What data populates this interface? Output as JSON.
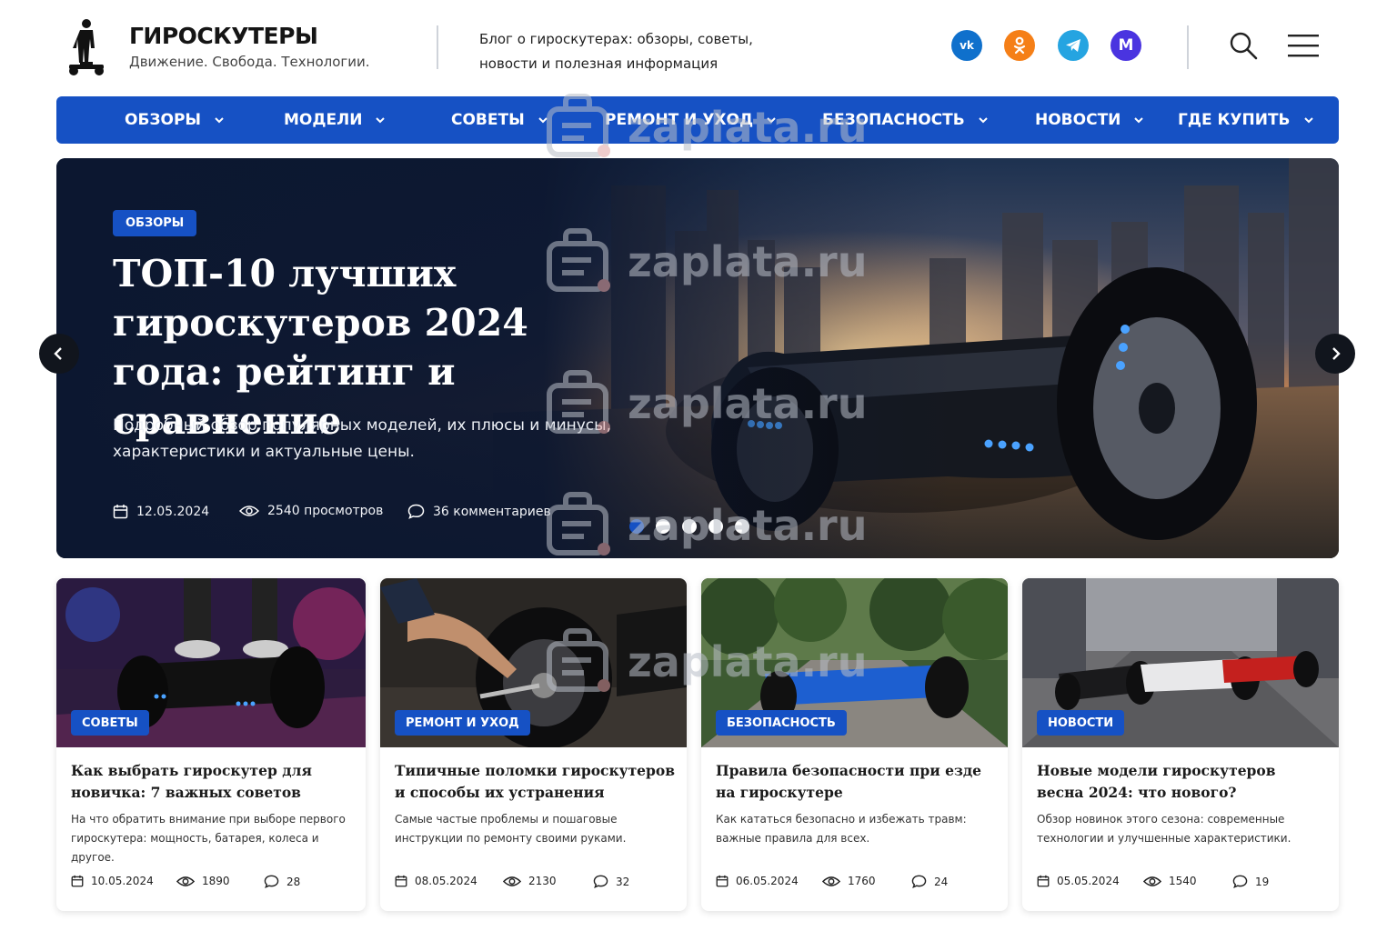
{
  "header": {
    "brand_title": "ГИРОСКУТЕРЫ",
    "brand_slogan": "Движение. Свобода. Технологии.",
    "tagline": "Блог о гироскутерах: обзоры, советы, новости и полезная информация",
    "social": [
      {
        "icon": "vk-icon",
        "color": "#0f70cc"
      },
      {
        "icon": "odnoklassniki-icon",
        "color": "#f57f17"
      },
      {
        "icon": "telegram-icon",
        "color": "#25a4e1"
      },
      {
        "icon": "max-icon",
        "color": "#4a34e0"
      }
    ],
    "social_vk_glyph": "vk",
    "social_max_glyph": "M"
  },
  "nav": {
    "items": [
      "ОБЗОРЫ",
      "МОДЕЛИ",
      "СОВЕТЫ",
      "РЕМОНТ И УХОД",
      "БЕЗОПАСНОСТЬ",
      "НОВОСТИ",
      "ГДЕ КУПИТЬ"
    ],
    "color": "#1651c4"
  },
  "hero": {
    "badge": "ОБЗОРЫ",
    "title": "ТОП-10 лучших гироскутеров 2024 года: рейтинг и сравнение",
    "description": "Подробный обзор популярных моделей, их плюсы и минусы, характеристики и актуальные цены.",
    "date": "12.05.2024",
    "views": "2540 просмотров",
    "comments": "36 комментариев",
    "slides_total": 5,
    "active_slide": 1
  },
  "cards": [
    {
      "badge": "СОВЕТЫ",
      "title": "Как выбрать гироскутер для новичка: 7 важных советов",
      "description": "На что обратить внимание при выборе первого гироскутера: мощность, батарея, колеса и другое.",
      "date": "10.05.2024",
      "views": "1890",
      "comments": "28"
    },
    {
      "badge": "РЕМОНТ И УХОД",
      "title": "Типичные поломки гироскутеров и способы их устранения",
      "description": "Самые частые проблемы и пошаговые инструкции по ремонту своими руками.",
      "date": "08.05.2024",
      "views": "2130",
      "comments": "32"
    },
    {
      "badge": "БЕЗОПАСНОСТЬ",
      "title": "Правила безопасности при езде на гироскутере",
      "description": "Как кататься безопасно и избежать травм: важные правила для всех.",
      "date": "06.05.2024",
      "views": "1760",
      "comments": "24"
    },
    {
      "badge": "НОВОСТИ",
      "title": "Новые модели гироскутеров весна 2024: что нового?",
      "description": "Обзор новинок этого сезона: современные технологии и улучшенные характеристики.",
      "date": "05.05.2024",
      "views": "1540",
      "comments": "19"
    }
  ],
  "watermark": "zaplata.ru"
}
